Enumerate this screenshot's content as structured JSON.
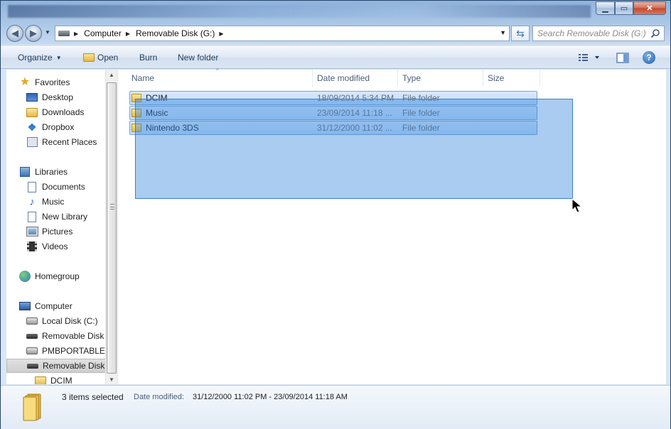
{
  "address": {
    "crumbs": [
      "Computer",
      "Removable Disk (G:)"
    ]
  },
  "search": {
    "placeholder": "Search Removable Disk (G:)"
  },
  "toolbar": {
    "organize": "Organize",
    "open": "Open",
    "burn": "Burn",
    "new_folder": "New folder"
  },
  "nav": {
    "favorites": "Favorites",
    "desktop": "Desktop",
    "downloads": "Downloads",
    "dropbox": "Dropbox",
    "recent_places": "Recent Places",
    "libraries": "Libraries",
    "documents": "Documents",
    "music": "Music",
    "new_library": "New Library",
    "pictures": "Pictures",
    "videos": "Videos",
    "homegroup": "Homegroup",
    "computer": "Computer",
    "local_disk": "Local Disk (C:)",
    "removable_1": "Removable Disk (",
    "pmbportable": "PMBPORTABLE (",
    "removable_2": "Removable Disk (",
    "dcim": "DCIM"
  },
  "columns": {
    "name": "Name",
    "date": "Date modified",
    "type": "Type",
    "size": "Size"
  },
  "files": [
    {
      "name": "DCIM",
      "date": "18/09/2014 5:34 PM",
      "type": "File folder"
    },
    {
      "name": "Music",
      "date": "23/09/2014 11:18 ...",
      "type": "File folder"
    },
    {
      "name": "Nintendo 3DS",
      "date": "31/12/2000 11:02 ...",
      "type": "File folder"
    }
  ],
  "details": {
    "selected": "3 items selected",
    "date_label": "Date modified:",
    "date_value": "31/12/2000 11:02 PM - 23/09/2014 11:18 AM"
  },
  "colors": {
    "selection_fill": "#c1dcfc",
    "marquee": "#3385dc"
  }
}
